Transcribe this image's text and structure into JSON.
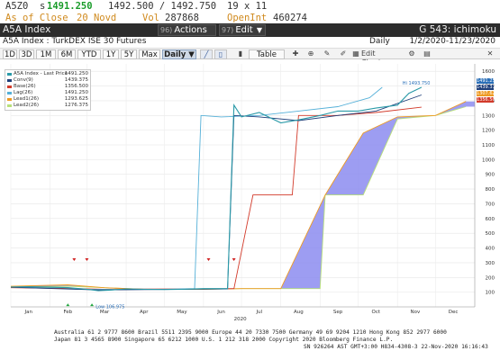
{
  "quote": {
    "ticker": "A5Z0",
    "last_prefix": "s",
    "last": "1491.250",
    "bid_ask": "1492.500 / 1492.750",
    "size": "19 x 11",
    "as_of_label": "As of Close",
    "as_of_date": "20 Novd",
    "vol_label": "Vol",
    "vol": "287868",
    "oi_label": "OpenInt",
    "oi": "460274"
  },
  "title_bar": {
    "name": "A5A Index",
    "actions_num": "96)",
    "actions_label": "Actions",
    "edit_num": "97)",
    "edit_label": "Edit",
    "right_title": "G 543: ichimoku"
  },
  "sub_bar": {
    "description": "A5A Index : TurkDEX ISE 30 Futures",
    "periodicity": "Daily",
    "date_range": "1/2/2020-11/23/2020"
  },
  "toolbar": {
    "ranges": [
      "1D",
      "3D",
      "1M",
      "6M",
      "YTD",
      "1Y",
      "5Y",
      "Max"
    ],
    "period_select": "Daily ▼",
    "table_label": "Table",
    "edit_chart_label": "Edit Chart"
  },
  "colors": {
    "last_price": "#2a9aa8",
    "conv": "#1f3f7a",
    "base": "#d23a2a",
    "lag": "#55b0d8",
    "lead1": "#ee9a22",
    "lead2": "#b8e07a",
    "cloud": "#8c8cf0",
    "up_arrow": "#28a845",
    "down_arrow": "#d02020"
  },
  "legend": [
    {
      "name": "A5A Index - Last Price",
      "value": "1491.250",
      "color": "#2a9aa8"
    },
    {
      "name": "Conv(9)",
      "value": "1439.375",
      "color": "#1f3f7a"
    },
    {
      "name": "Base(26)",
      "value": "1356.500",
      "color": "#d23a2a"
    },
    {
      "name": "Lag(26)",
      "value": "1491.250",
      "color": "#55b0d8"
    },
    {
      "name": "Lead1(26)",
      "value": "1293.625",
      "color": "#ee9a22"
    },
    {
      "name": "Lead2(26)",
      "value": "1276.375",
      "color": "#b8e07a"
    }
  ],
  "price_tags": [
    {
      "value": "1491.250",
      "color": "#2a6fb8"
    },
    {
      "value": "1439.375",
      "color": "#1f3f7a"
    },
    {
      "value": "1307.625",
      "color": "#ee9a22"
    },
    {
      "value": "1356.500",
      "color": "#d23a2a"
    }
  ],
  "chart_data": {
    "type": "line",
    "title": "",
    "xlabel": "2020",
    "ylabel": "",
    "ylim": [
      0,
      1650
    ],
    "y_ticks": [
      0,
      100,
      200,
      300,
      400,
      500,
      600,
      700,
      800,
      900,
      1000,
      1100,
      1200,
      1300,
      1400,
      1500,
      1600
    ],
    "x_months": [
      "Jan",
      "Feb",
      "Mar",
      "Apr",
      "May",
      "Jun",
      "Jul",
      "Aug",
      "Sep",
      "Oct",
      "Nov",
      "Dec"
    ],
    "annotations": [
      {
        "text": "Hi 1493.750",
        "x": "Nov"
      },
      {
        "text": "Low 106.975",
        "x": "Mar"
      }
    ],
    "series": [
      {
        "name": "A5A Index - Last Price",
        "x": [
          "Jan 1",
          "Jan 15",
          "Feb 1",
          "Feb 15",
          "Mar 1",
          "Mar 10",
          "Mar 20",
          "Apr 1",
          "Apr 15",
          "May 1",
          "May 15",
          "Jun 1",
          "Jun 20",
          "Jun 25",
          "Jul 1",
          "Jul 15",
          "Aug 1",
          "Aug 15",
          "Sep 1",
          "Sep 15",
          "Oct 1",
          "Oct 15",
          "Nov 1",
          "Nov 10",
          "Nov 20"
        ],
        "values": [
          135,
          137,
          134,
          131,
          120,
          110,
          114,
          122,
          120,
          118,
          120,
          124,
          124,
          1370,
          1290,
          1320,
          1250,
          1270,
          1300,
          1330,
          1330,
          1350,
          1370,
          1450,
          1491
        ]
      },
      {
        "name": "Conv(9)",
        "x": [
          "Jan 1",
          "Mar 10",
          "Jun 20",
          "Jun 25",
          "Jul 15",
          "Aug 15",
          "Sep 15",
          "Oct 15",
          "Nov 20"
        ],
        "values": [
          133,
          115,
          122,
          1300,
          1290,
          1265,
          1300,
          1330,
          1439
        ]
      },
      {
        "name": "Base(26)",
        "x": [
          "Jan 1",
          "Feb 15",
          "Mar 15",
          "Jun 1",
          "Jun 25",
          "Jul 10",
          "Jul 20",
          "Aug 10",
          "Aug 15",
          "Sep 15",
          "Oct 15",
          "Nov 20"
        ],
        "values": [
          130,
          125,
          120,
          122,
          124,
          760,
          760,
          760,
          1300,
          1300,
          1320,
          1356
        ]
      },
      {
        "name": "Lag(26)",
        "x": [
          "Jan 1",
          "Feb 10",
          "Mar 1",
          "Apr 1",
          "May 1",
          "May 25",
          "May 30",
          "Jun 15",
          "Jul 15",
          "Aug 15",
          "Sep 15",
          "Oct 10",
          "Oct 20"
        ],
        "values": [
          134,
          132,
          120,
          118,
          120,
          124,
          1300,
          1290,
          1300,
          1330,
          1360,
          1420,
          1491
        ]
      },
      {
        "name": "Lead1(26)",
        "x": [
          "Jan 1",
          "Feb 15",
          "Mar 15",
          "Apr 15",
          "Jun 1",
          "Jul 1",
          "Jul 20",
          "Aug 1",
          "Sep 5",
          "Oct 5",
          "Nov 1",
          "Dec 1",
          "Dec 25"
        ],
        "values": [
          140,
          150,
          130,
          120,
          120,
          124,
          124,
          124,
          760,
          1180,
          1290,
          1300,
          1395
        ]
      },
      {
        "name": "Lead2(26)",
        "x": [
          "Jan 1",
          "Feb 15",
          "Mar 15",
          "Apr 15",
          "Jun 1",
          "Jul 1",
          "Aug 1",
          "Aug 20",
          "Sep 1",
          "Sep 5",
          "Oct 5",
          "Nov 1",
          "Dec 1",
          "Dec 25"
        ],
        "values": [
          135,
          140,
          130,
          120,
          120,
          124,
          124,
          124,
          124,
          760,
          760,
          1276,
          1300,
          1360
        ]
      }
    ]
  },
  "footer": {
    "line1": "Australia 61 2 9777 8600  Brazil 5511 2395 9000  Europe 44 20 7330 7500  Germany 49 69 9204 1210  Hong Kong 852 2977 6000",
    "line2": "Japan 81 3 4565 8900        Singapore 65 6212 1000       U.S. 1 212 318 2000              Copyright 2020 Bloomberg Finance L.P.",
    "line3": "SN 926264 AST  GMT+3:00 H834-4308-3 22-Nov-2020 16:16:43"
  }
}
